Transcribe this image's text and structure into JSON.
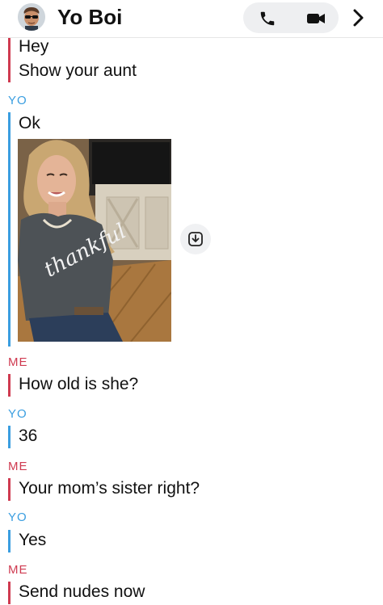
{
  "header": {
    "title": "Yo Boi",
    "icons": {
      "avatar": "bitmoji-avatar",
      "call": "phone-icon",
      "video": "video-camera-icon",
      "more": "chevron-right-icon"
    }
  },
  "messages": [
    {
      "sender": "",
      "text": "Hey"
    },
    {
      "sender": "",
      "text": "Show your aunt"
    },
    {
      "sender": "YO",
      "text": "Ok"
    },
    {
      "sender": "ME",
      "text": "How old is she?"
    },
    {
      "sender": "YO",
      "text": "36"
    },
    {
      "sender": "ME",
      "text": "Your mom’s sister right?"
    },
    {
      "sender": "YO",
      "text": "Yes"
    },
    {
      "sender": "ME",
      "text": "Send nudes now"
    }
  ],
  "media": {
    "shirt_text": "thankful",
    "save_icon": "save-to-chat-icon"
  },
  "colors": {
    "me": "#cf3a50",
    "yo": "#3a9ee0"
  }
}
